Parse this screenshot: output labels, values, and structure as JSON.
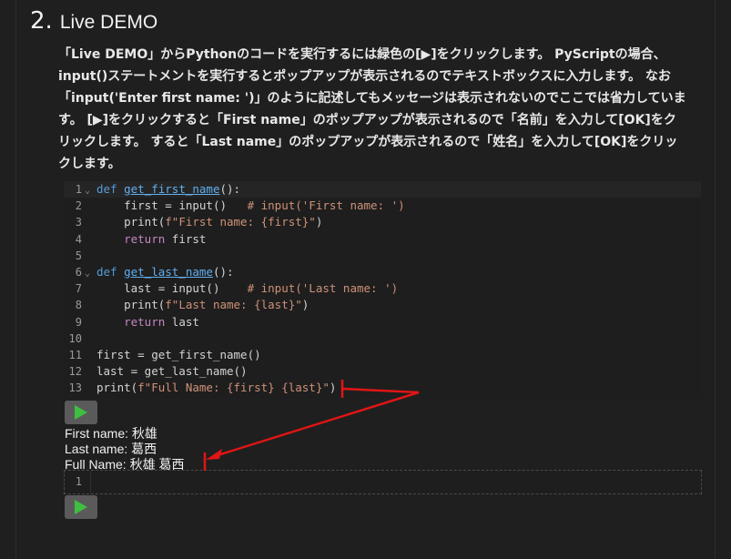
{
  "section": {
    "number": "2.",
    "title": "Live DEMO"
  },
  "description": {
    "line1": "「Live DEMO」からPythonのコードを実行するには緑色の[▶]をクリックします。 PyScriptの場合、",
    "line2": "input()ステートメントを実行するとポップアップが表示されるのでテキストボックスに入力します。 なお",
    "line3": "「input('Enter first name: ')」のように記述してもメッセージは表示されないのでここでは省力していま",
    "line4": "す。 [▶]をクリックすると「First name」のポップアップが表示されるので「名前」を入力して[OK]をク",
    "line5": "リックします。 すると「Last name」のポップアップが表示されるので「姓名」を入力して[OK]をクリッ",
    "line6": "クします。"
  },
  "code_editor": {
    "line_numbers": [
      "1",
      "2",
      "3",
      "4",
      "5",
      "6",
      "7",
      "8",
      "9",
      "10",
      "11",
      "12",
      "13"
    ],
    "lines": [
      {
        "kw": "def ",
        "fn": "get_first_name",
        "rest": "():"
      },
      {
        "indent": "    ",
        "a": "first = input()   ",
        "comment": "# input('First name: ')"
      },
      {
        "indent": "    ",
        "a": "print(",
        "str": "f\"First name: {first}\"",
        "b": ")"
      },
      {
        "indent": "    ",
        "kw": "return",
        "b": " first"
      },
      {},
      {
        "kw": "def ",
        "fn": "get_last_name",
        "rest": "():"
      },
      {
        "indent": "    ",
        "a": "last = input()    ",
        "comment": "# input('Last name: ')"
      },
      {
        "indent": "    ",
        "a": "print(",
        "str": "f\"Last name: {last}\"",
        "b": ")"
      },
      {
        "indent": "    ",
        "kw": "return",
        "b": " last"
      },
      {},
      {
        "a": "first = get_first_name()"
      },
      {
        "a": "last = get_last_name()"
      },
      {
        "a": "print(",
        "str": "f\"Full Name: {first} {last}\"",
        "b": ")"
      }
    ]
  },
  "output": {
    "line1": "First name: 秋雄",
    "line2": "Last name: 葛西",
    "line3": "Full Name: 秋雄 葛西"
  },
  "empty_editor": {
    "line_number": "1"
  },
  "colors": {
    "run_icon": "#3fbf3f",
    "annotation_arrow": "#e01515"
  },
  "icons": {
    "run": "play-icon",
    "fold": "chevron-down-icon"
  }
}
